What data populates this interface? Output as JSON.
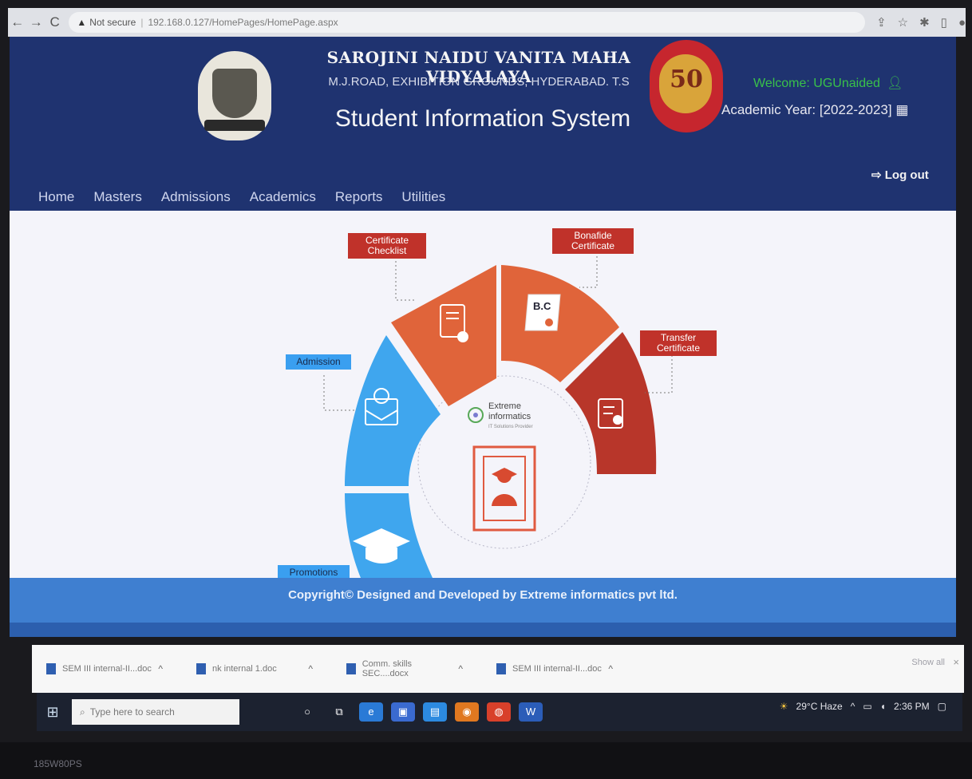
{
  "browser": {
    "security_label": "Not secure",
    "url": "192.168.0.127/HomePages/HomePage.aspx"
  },
  "header": {
    "college_name": "SAROJINI NAIDU VANITA MAHA VIDYALAYA",
    "address": "M.J.ROAD, EXHIBITION GROUNDS, HYDERABAD. T.S",
    "system_name": "Student Information System",
    "logo_number": "50",
    "welcome": "Welcome: UGUnaided",
    "academic_year": "Academic Year: [2022-2023]",
    "logout": "Log out"
  },
  "menu": {
    "items": [
      "Home",
      "Masters",
      "Admissions",
      "Academics",
      "Reports",
      "Utilities"
    ]
  },
  "diagram": {
    "labels": {
      "certificate_checklist": "Certificate Checklist",
      "bonafide_certificate": "Bonafide Certificate",
      "transfer_certificate": "Transfer Certificate",
      "admission": "Admission",
      "promotions": "Promotions"
    },
    "bc_text": "B.C",
    "center_brand": "Extreme",
    "center_brand2": "informatics",
    "center_tagline": "IT Solutions Provider",
    "colors": {
      "orange": "#e0643a",
      "dark_red": "#b8362a",
      "blue": "#3fa6ee",
      "label_red": "#c0322a",
      "label_blue": "#3a9ff0"
    }
  },
  "footer": {
    "copyright": "Copyright© Designed and Developed by Extreme informatics pvt ltd."
  },
  "downloads": {
    "items": [
      "SEM III internal-II...doc",
      "nk internal 1.doc",
      "Comm. skills SEC....docx",
      "SEM III internal-II...doc"
    ],
    "show_all": "Show all"
  },
  "taskbar": {
    "search_placeholder": "Type here to search",
    "weather": "29°C Haze",
    "time": "2:36 PM"
  },
  "monitor": {
    "label": "185W80PS"
  }
}
